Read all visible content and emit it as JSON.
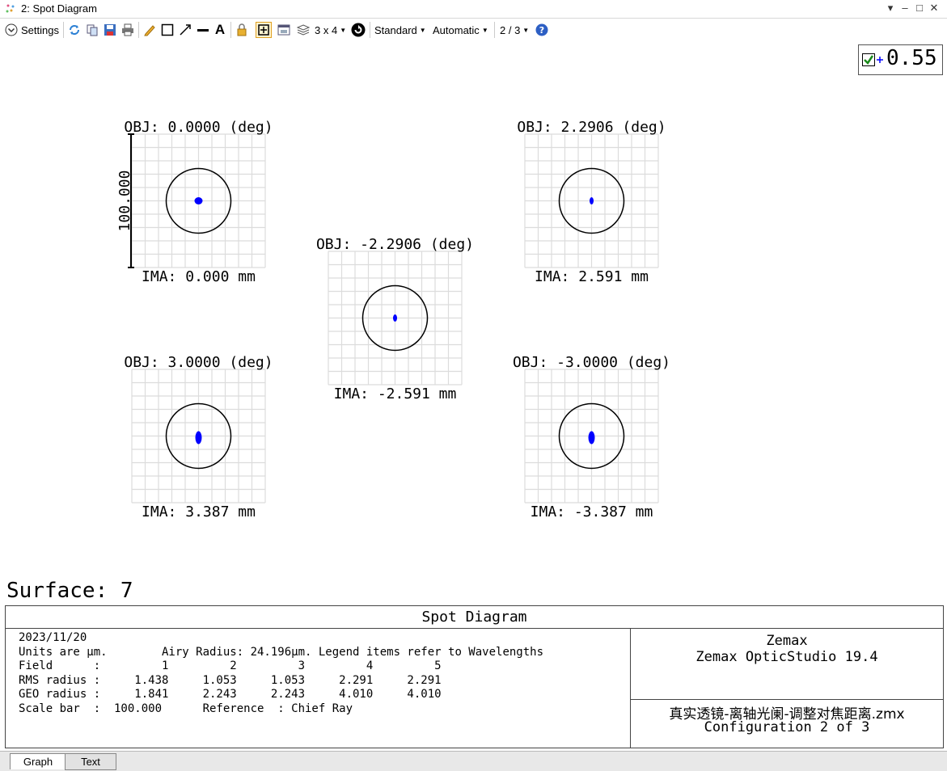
{
  "window": {
    "title": "2: Spot Diagram"
  },
  "toolbar": {
    "settings_label": "Settings",
    "layout_label": "3 x 4",
    "standard_label": "Standard",
    "automatic_label": "Automatic",
    "config_label": "2 / 3"
  },
  "wavelength": {
    "value": "0.55",
    "checked": true,
    "color": "#0000ff"
  },
  "scale_bar_label": "100.000",
  "fields": [
    {
      "obj": "OBJ: 0.0000 (deg)",
      "ima": "IMA: 0.000 mm",
      "spot": "dot"
    },
    {
      "obj": "OBJ: 2.2906 (deg)",
      "ima": "IMA: 2.591 mm",
      "spot": "thin"
    },
    {
      "obj": "OBJ: -2.2906 (deg)",
      "ima": "IMA: -2.591 mm",
      "spot": "thin"
    },
    {
      "obj": "OBJ: 3.0000 (deg)",
      "ima": "IMA: 3.387 mm",
      "spot": "tall"
    },
    {
      "obj": "OBJ: -3.0000 (deg)",
      "ima": "IMA: -3.387 mm",
      "spot": "tall"
    }
  ],
  "surface_label": "Surface: 7",
  "info": {
    "title": "Spot Diagram",
    "lines": [
      "2023/11/20",
      "Units are µm.        Airy Radius: 24.196µm. Legend items refer to Wavelengths",
      "Field      :         1         2         3         4         5",
      "RMS radius :     1.438     1.053     1.053     2.291     2.291",
      "GEO radius :     1.841     2.243     2.243     4.010     4.010",
      "Scale bar  :  100.000      Reference  : Chief Ray"
    ],
    "company": "Zemax",
    "product": "Zemax OpticStudio 19.4",
    "filename": "真实透镜-离轴光阑-调整对焦距离.zmx",
    "configuration": "Configuration 2 of 3"
  },
  "tabs": [
    {
      "label": "Graph",
      "active": true
    },
    {
      "label": "Text",
      "active": false
    }
  ],
  "colors": {
    "spot": "#0000ff",
    "grid": "#dcdcdc",
    "accent": "#f0c040"
  }
}
